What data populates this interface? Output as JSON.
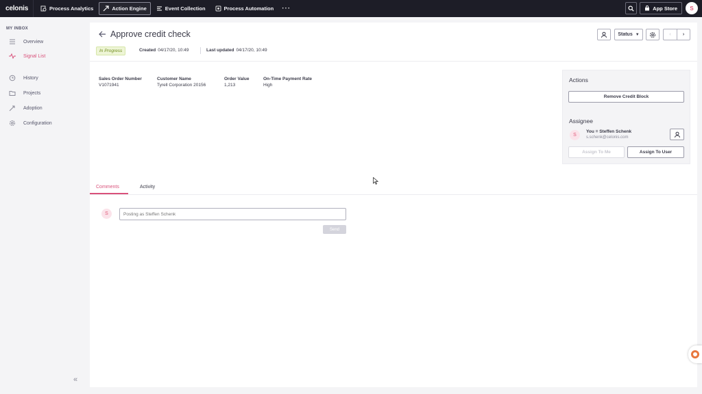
{
  "topbar": {
    "brand": "celonis",
    "nav": [
      {
        "label": "Process Analytics",
        "icon": "gear-doc-icon",
        "active": false
      },
      {
        "label": "Action Engine",
        "icon": "action-engine-icon",
        "active": true
      },
      {
        "label": "Event Collection",
        "icon": "event-collection-icon",
        "active": false
      },
      {
        "label": "Process Automation",
        "icon": "automation-icon",
        "active": false
      }
    ],
    "more": "···",
    "app_store": "App Store",
    "avatar": "S"
  },
  "sidebar": {
    "header": "MY INBOX",
    "items": [
      {
        "label": "Overview",
        "icon": "overview-icon"
      },
      {
        "label": "Signal List",
        "icon": "pulse-icon",
        "active": true
      },
      {
        "label": "History",
        "icon": "history-icon"
      },
      {
        "label": "Projects",
        "icon": "folder-icon"
      },
      {
        "label": "Adoption",
        "icon": "adoption-icon"
      },
      {
        "label": "Configuration",
        "icon": "settings-icon"
      }
    ]
  },
  "header": {
    "title": "Approve credit check",
    "status_badge": "In Progress",
    "created_label": "Created",
    "created_value": "04/17/20, 10:49",
    "updated_label": "Last updated",
    "updated_value": "04/17/20, 10:49",
    "status_button": "Status"
  },
  "fields": [
    {
      "label": "Sales Order Number",
      "value": "V1071941"
    },
    {
      "label": "Customer Name",
      "value": "Tyrell Corporation 20156"
    },
    {
      "label": "Order Value",
      "value": "1,213"
    },
    {
      "label": "On-Time Payment Rate",
      "value": "High"
    }
  ],
  "actions": {
    "heading": "Actions",
    "remove_credit_block": "Remove Credit Block",
    "assignee_heading": "Assignee",
    "assignee_avatar": "S",
    "assignee_name": "You = Steffen Schenk",
    "assignee_email": "s.schenk@celonis.com",
    "assign_to_me": "Assign To Me",
    "assign_to_user": "Assign To User"
  },
  "tabs": [
    {
      "label": "Comments",
      "active": true
    },
    {
      "label": "Activity",
      "active": false
    }
  ],
  "comments": {
    "avatar": "S",
    "placeholder": "Posting as Steffen Schenk",
    "send": "Send"
  },
  "colors": {
    "topbar": "#1d1d27",
    "accent": "#d9507a",
    "badge_bg": "#eef5d6",
    "badge_text": "#6f8c1b"
  }
}
